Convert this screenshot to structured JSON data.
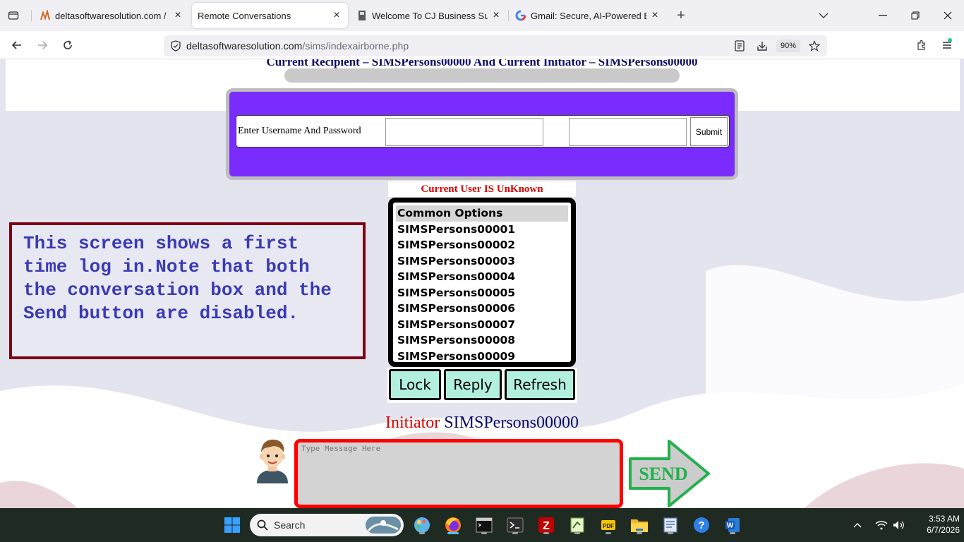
{
  "browser": {
    "tabs": [
      {
        "title": "deltasoftwaresolution.com / loc",
        "favicon": "pma-icon",
        "active": false
      },
      {
        "title": "Remote Conversations",
        "favicon": "",
        "active": true
      },
      {
        "title": "Welcome To CJ Business Suppo",
        "favicon": "book-icon",
        "active": false
      },
      {
        "title": "Gmail: Secure, AI-Powered Ema",
        "favicon": "google-icon",
        "active": false
      }
    ],
    "url_domain": "deltasoftwaresolution.com",
    "url_path": "/sims/indexairborne.php",
    "zoom": "90%"
  },
  "page": {
    "recipient_line": "Current Recipient – SIMSPersons00000 And Current Initiator – SIMSPersons00000",
    "login": {
      "label": "Enter Username And Password",
      "username_value": "",
      "password_value": "",
      "submit_label": "Submit"
    },
    "current_user": "Current User IS UnKnown",
    "options_list": {
      "items": [
        "Common Options",
        "SIMSPersons00001",
        "SIMSPersons00002",
        "SIMSPersons00003",
        "SIMSPersons00004",
        "SIMSPersons00005",
        "SIMSPersons00006",
        "SIMSPersons00007",
        "SIMSPersons00008",
        "SIMSPersons00009"
      ],
      "selected_index": 0
    },
    "buttons": {
      "lock": "Lock",
      "reply": "Reply",
      "refresh": "Refresh"
    },
    "note": "This screen shows a first time log in.Note that both the conversation box and the Send button are disabled.",
    "initiator_label": "Initiator",
    "initiator_name": "SIMSPersons00000",
    "message_placeholder": "Type Message Here",
    "send_label": "SEND"
  },
  "taskbar": {
    "search_label": "Search",
    "time": "3:53 AM",
    "date": "6/7/2026"
  },
  "colors": {
    "login_bg": "#7a2cff",
    "list_selected": "#d6d6d6",
    "action_buttons": "#b3efdf",
    "note_border": "#7b0014",
    "note_text": "#3b3bb5",
    "message_border": "#ff0000",
    "send_arrow_border": "#22b14c"
  }
}
